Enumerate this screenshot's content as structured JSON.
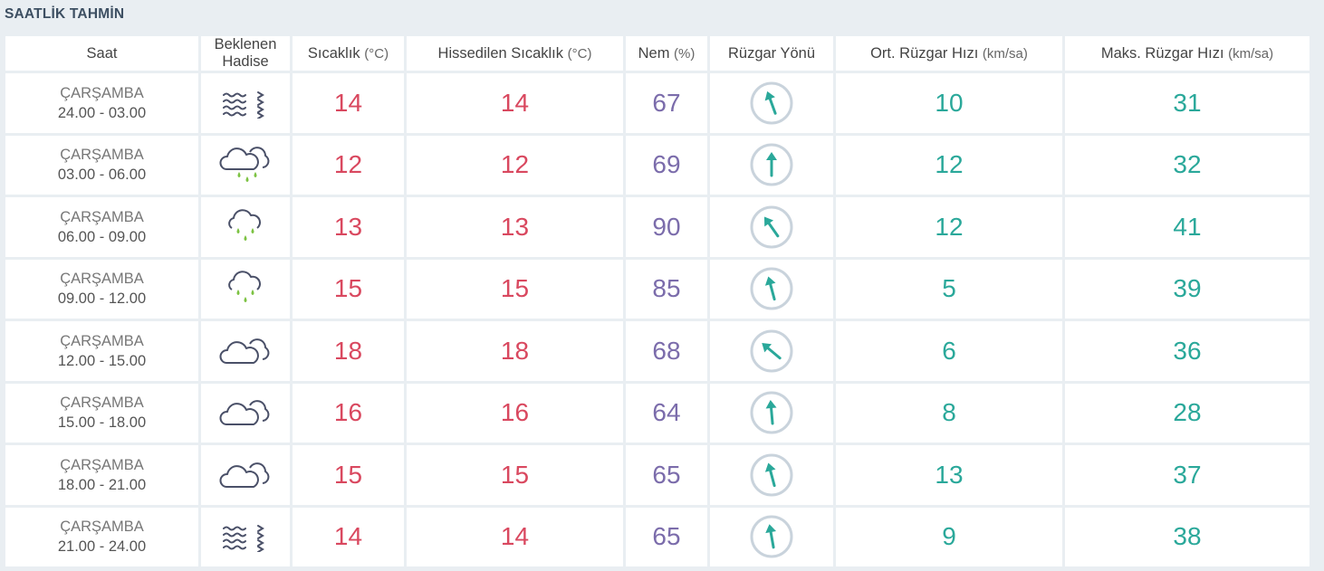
{
  "title": "SAATLİK TAHMİN",
  "headers": {
    "time": "Saat",
    "event_line1": "Beklenen",
    "event_line2": "Hadise",
    "temp": "Sıcaklık",
    "temp_unit": "(°C)",
    "feels": "Hissedilen Sıcaklık",
    "feels_unit": "(°C)",
    "humidity": "Nem",
    "humidity_unit": "(%)",
    "wind_dir": "Rüzgar Yönü",
    "wind_avg": "Ort. Rüzgar Hızı",
    "wind_avg_unit": "(km/sa)",
    "wind_max": "Maks. Rüzgar Hızı",
    "wind_max_unit": "(km/sa)"
  },
  "colors": {
    "temperature": "#d9485f",
    "humidity": "#7b6cab",
    "wind": "#2aa89a",
    "rain_drop": "#7cc242",
    "icon_stroke": "#4a5068"
  },
  "rows": [
    {
      "day": "ÇARŞAMBA",
      "range": "24.00 - 03.00",
      "icon": "fog-icon",
      "temp": "14",
      "feels": "14",
      "humidity": "67",
      "wind_dir_deg": -20,
      "wind_avg": "10",
      "wind_max": "31"
    },
    {
      "day": "ÇARŞAMBA",
      "range": "03.00 - 06.00",
      "icon": "rain-cloud-icon",
      "temp": "12",
      "feels": "12",
      "humidity": "69",
      "wind_dir_deg": 0,
      "wind_avg": "12",
      "wind_max": "32"
    },
    {
      "day": "ÇARŞAMBA",
      "range": "06.00 - 09.00",
      "icon": "light-rain-icon",
      "temp": "13",
      "feels": "13",
      "humidity": "90",
      "wind_dir_deg": -35,
      "wind_avg": "12",
      "wind_max": "41"
    },
    {
      "day": "ÇARŞAMBA",
      "range": "09.00 - 12.00",
      "icon": "light-rain-icon",
      "temp": "15",
      "feels": "15",
      "humidity": "85",
      "wind_dir_deg": -15,
      "wind_avg": "5",
      "wind_max": "39"
    },
    {
      "day": "ÇARŞAMBA",
      "range": "12.00 - 15.00",
      "icon": "cloudy-icon",
      "temp": "18",
      "feels": "18",
      "humidity": "68",
      "wind_dir_deg": -50,
      "wind_avg": "6",
      "wind_max": "36"
    },
    {
      "day": "ÇARŞAMBA",
      "range": "15.00 - 18.00",
      "icon": "cloudy-icon",
      "temp": "16",
      "feels": "16",
      "humidity": "64",
      "wind_dir_deg": -5,
      "wind_avg": "8",
      "wind_max": "28"
    },
    {
      "day": "ÇARŞAMBA",
      "range": "18.00 - 21.00",
      "icon": "cloudy-icon",
      "temp": "15",
      "feels": "15",
      "humidity": "65",
      "wind_dir_deg": -15,
      "wind_avg": "13",
      "wind_max": "37"
    },
    {
      "day": "ÇARŞAMBA",
      "range": "21.00 - 24.00",
      "icon": "fog-icon",
      "temp": "14",
      "feels": "14",
      "humidity": "65",
      "wind_dir_deg": -10,
      "wind_avg": "9",
      "wind_max": "38"
    }
  ]
}
